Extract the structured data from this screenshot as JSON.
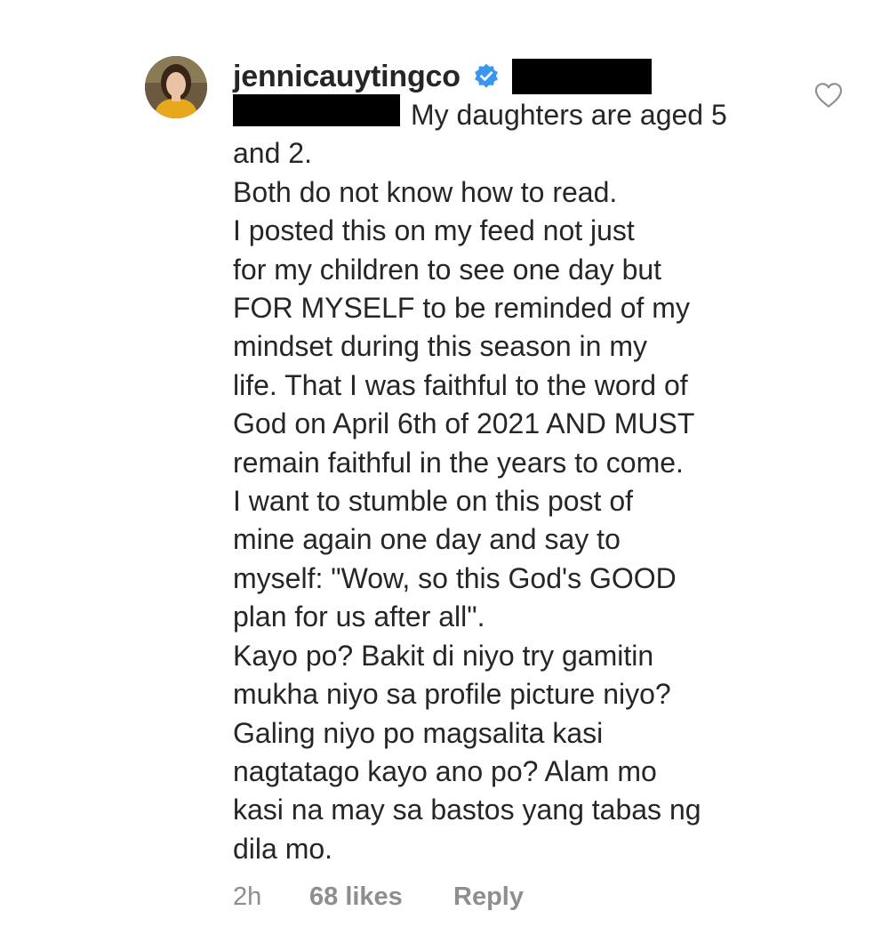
{
  "comment": {
    "username": "jennicauytingco",
    "verified": true,
    "icons": {
      "verified": "verified-badge-icon",
      "like": "heart-outline-icon",
      "avatar": "profile-photo"
    },
    "colors": {
      "verified_badge": "#3897f0",
      "meta_text": "#8e8e8e",
      "body_text": "#262626",
      "redaction": "#000000"
    },
    "lines": [
      "My daughters are aged 5",
      "and 2.",
      "Both do not know how to read.",
      "I posted this on my feed not just",
      "for my children to see one day but",
      "FOR MYSELF to be reminded of my",
      "mindset during this season in my",
      "life. That I was faithful to the word of",
      "God on April 6th of 2021 AND MUST",
      "remain faithful in the years to come.",
      "I want to stumble on this post of",
      "mine again one day and say to",
      "myself: \"Wow, so this God's GOOD",
      "plan for us after all\".",
      "Kayo po? Bakit di niyo try gamitin",
      "mukha niyo sa profile picture niyo?",
      "Galing niyo po magsalita kasi",
      "nagtatago kayo ano po? Alam mo",
      "kasi na may sa bastos yang tabas ng",
      "dila mo."
    ],
    "meta": {
      "time": "2h",
      "likes": "68 likes",
      "reply": "Reply"
    }
  }
}
